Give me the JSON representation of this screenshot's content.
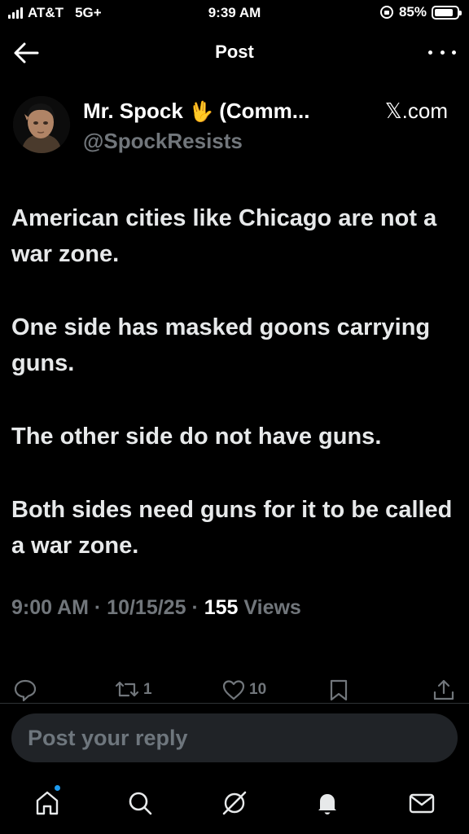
{
  "status_bar": {
    "carrier": "AT&T",
    "network": "5G+",
    "time": "9:39 AM",
    "battery_percent": "85%",
    "battery_level": 0.85
  },
  "header": {
    "title": "Post"
  },
  "tweet": {
    "display_name": "Mr. Spock",
    "name_emoji": "🖖",
    "name_suffix": "(Comm...",
    "source": "𝕏.com",
    "handle": "@SpockResists",
    "paragraphs": [
      "American cities like Chicago are not a war zone.",
      "One side has masked goons carrying guns.",
      "The other side do not have guns.",
      "Both sides need guns for it to be called a war zone."
    ],
    "time": "9:00 AM",
    "date": "10/15/25",
    "views_count": "155",
    "views_label": "Views",
    "reposts": "1",
    "likes": "10"
  },
  "reply": {
    "placeholder": "Post your reply"
  },
  "icons": {
    "back": "arrow-left-icon",
    "more": "more-dots-icon",
    "reply": "comment-icon",
    "repost": "repost-icon",
    "like": "heart-icon",
    "bookmark": "bookmark-icon",
    "share": "share-icon",
    "home": "home-icon",
    "search": "search-icon",
    "grok": "grok-icon",
    "notifications": "bell-icon",
    "messages": "mail-icon"
  }
}
